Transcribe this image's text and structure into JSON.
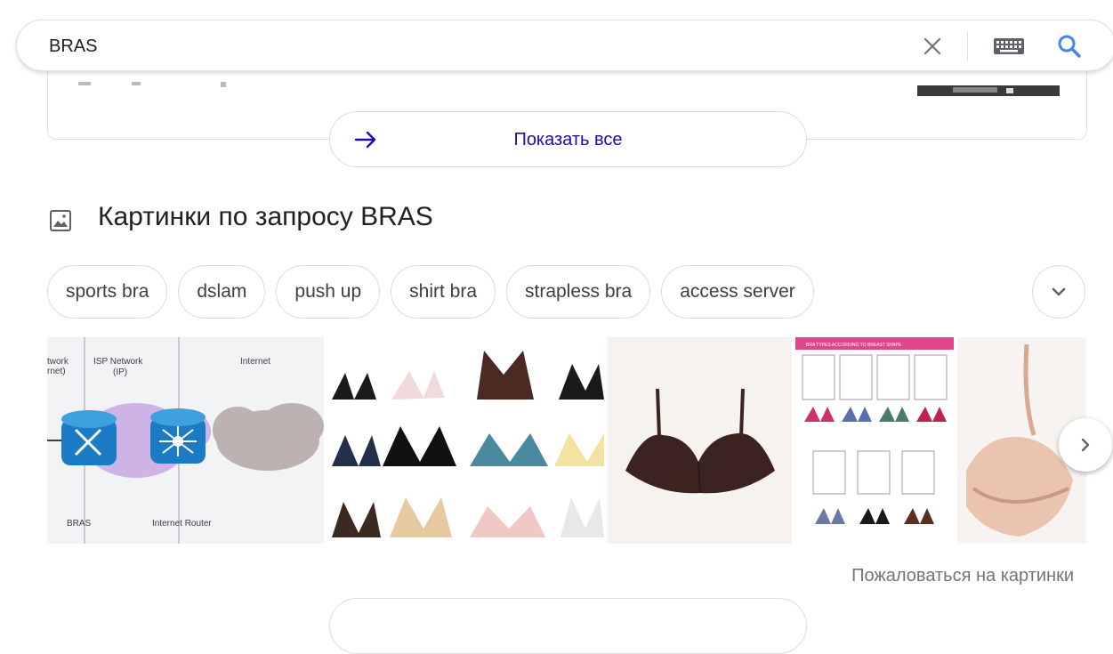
{
  "search": {
    "query": "BRAS",
    "icons": [
      "clear-icon",
      "keyboard-icon",
      "search-icon"
    ],
    "accent_color": "#4285f4"
  },
  "show_all": {
    "label": "Показать все",
    "icon": "arrow-right-icon",
    "color": "#1a0dab"
  },
  "images_section": {
    "title": "Картинки по запросу BRAS",
    "icon": "image-icon",
    "chips": [
      "sports bra",
      "dslam",
      "push up",
      "shirt bra",
      "strapless bra",
      "access server"
    ],
    "thumbs": [
      {
        "kind": "network-diagram",
        "labels": [
          "twork",
          "rnet)",
          "ISP Network",
          "(IP)",
          "Internet",
          "BRAS",
          "Internet Router"
        ]
      },
      {
        "kind": "bra-grid"
      },
      {
        "kind": "single-bra"
      },
      {
        "kind": "bra-chart",
        "header": "BRA TYPES ACCORDING TO BREAST SHAPE"
      },
      {
        "kind": "sheer-bra"
      }
    ],
    "report_label": "Пожаловаться на картинки"
  }
}
